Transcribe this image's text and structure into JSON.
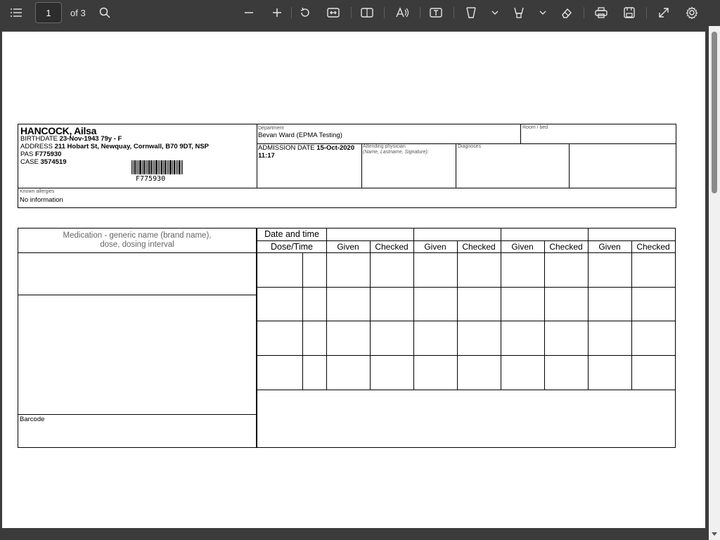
{
  "toolbar": {
    "current_page": "1",
    "page_total": "of 3",
    "icons": [
      "contents-icon",
      "search-icon",
      "zoom-out-icon",
      "zoom-in-icon",
      "rotate-icon",
      "fit-width-icon",
      "page-view-icon",
      "read-aloud-icon",
      "text-box-icon",
      "draw-icon",
      "highlight-icon",
      "eraser-icon",
      "print-icon",
      "save-icon",
      "fullscreen-icon",
      "settings-icon"
    ]
  },
  "patient": {
    "name": "HANCOCK, Ailsa",
    "birthdate_label": "BIRTHDATE",
    "birthdate_value": "23-Nov-1943 79y - F",
    "address_label": "ADDRESS",
    "address_value": "211 Hobart St, Newquay, Cornwall, B70 9DT, NSP",
    "pas_label": "PAS",
    "pas_value": "F775930",
    "case_label": "CASE",
    "case_value": "3574519",
    "barcode_text": "F775930"
  },
  "department": {
    "label": "Department",
    "value": "Bevan Ward (EPMA Testing)"
  },
  "room": {
    "label": "Room / bed",
    "value": ""
  },
  "admission": {
    "label": "ADMISSION DATE",
    "date": "15-Oct-2020",
    "time": "11:17"
  },
  "physician": {
    "label": "Attending physician",
    "hint": "(Name, Lastname, Signature):"
  },
  "diagnoses": {
    "label": "Diagnoses"
  },
  "allergies": {
    "label": "Known allergies",
    "value": "No information"
  },
  "med_table": {
    "med_header_line1": "Medication - generic name (brand name),",
    "med_header_line2": "dose, dosing interval",
    "date_time": "Date and time",
    "dose_time": "Dose/Time",
    "given": "Given",
    "checked": "Checked",
    "barcode_label": "Barcode"
  }
}
